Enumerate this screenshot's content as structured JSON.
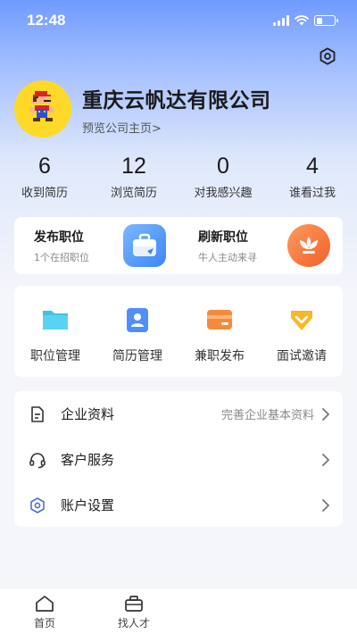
{
  "status": {
    "time": "12:48"
  },
  "profile": {
    "company_name": "重庆云帆达有限公司",
    "homepage_link": "预览公司主页>"
  },
  "stats": [
    {
      "value": "6",
      "label": "收到简历"
    },
    {
      "value": "12",
      "label": "浏览简历"
    },
    {
      "value": "0",
      "label": "对我感兴趣"
    },
    {
      "value": "4",
      "label": "谁看过我"
    }
  ],
  "publish": {
    "post": {
      "title": "发布职位",
      "subtitle": "1个在招职位",
      "icon": "briefcase-icon"
    },
    "refresh": {
      "title": "刷新职位",
      "subtitle": "牛人主动来寻",
      "icon": "flower-icon"
    }
  },
  "tools": [
    {
      "label": "职位管理",
      "icon": "folder-icon",
      "color": "#3cc3e6"
    },
    {
      "label": "简历管理",
      "icon": "resume-icon",
      "color": "#4f8ff7"
    },
    {
      "label": "兼职发布",
      "icon": "card-icon",
      "color": "#f58a3a"
    },
    {
      "label": "面试邀请",
      "icon": "badge-icon",
      "color": "#f7b928"
    }
  ],
  "menu": [
    {
      "label": "企业资料",
      "hint": "完善企业基本资料",
      "icon": "document-icon"
    },
    {
      "label": "客户服务",
      "hint": "",
      "icon": "headset-icon"
    },
    {
      "label": "账户设置",
      "hint": "",
      "icon": "hexagon-settings-icon"
    }
  ],
  "tabbar": [
    {
      "label": "首页",
      "icon": "home-icon"
    },
    {
      "label": "找人才",
      "icon": "briefcase-icon"
    }
  ],
  "colors": {
    "accent": "#4f8ff7",
    "header_top": "#6f9bff"
  }
}
